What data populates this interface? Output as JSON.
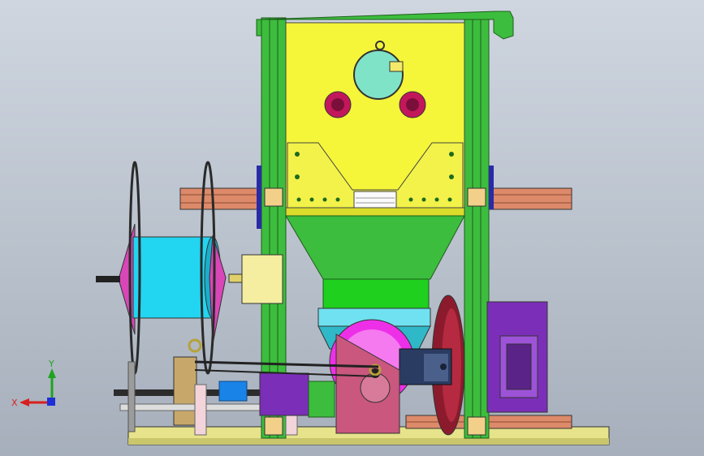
{
  "viewport": {
    "background_top": "#cfd6e0",
    "background_bottom": "#a6afbb"
  },
  "triad": {
    "x_label": "X",
    "y_label": "Y",
    "x_color": "#d81e1e",
    "y_color": "#1fa31f",
    "z_color": "#1e2fd8"
  },
  "model": {
    "colors": {
      "hopper": "#f5f53a",
      "frame_green": "#3dbd3d",
      "extrusion": "#dd8a6a",
      "spool": "#22d5f0",
      "spool_flange": "#d946b8",
      "motor_body": "#7b2fb8",
      "gear_pink": "#c9577e",
      "cylinder_magenta": "#ee2fe8",
      "base_plate": "#e6e38a",
      "knob_red": "#c2185b",
      "gauge_teal": "#7fe3c8"
    }
  }
}
